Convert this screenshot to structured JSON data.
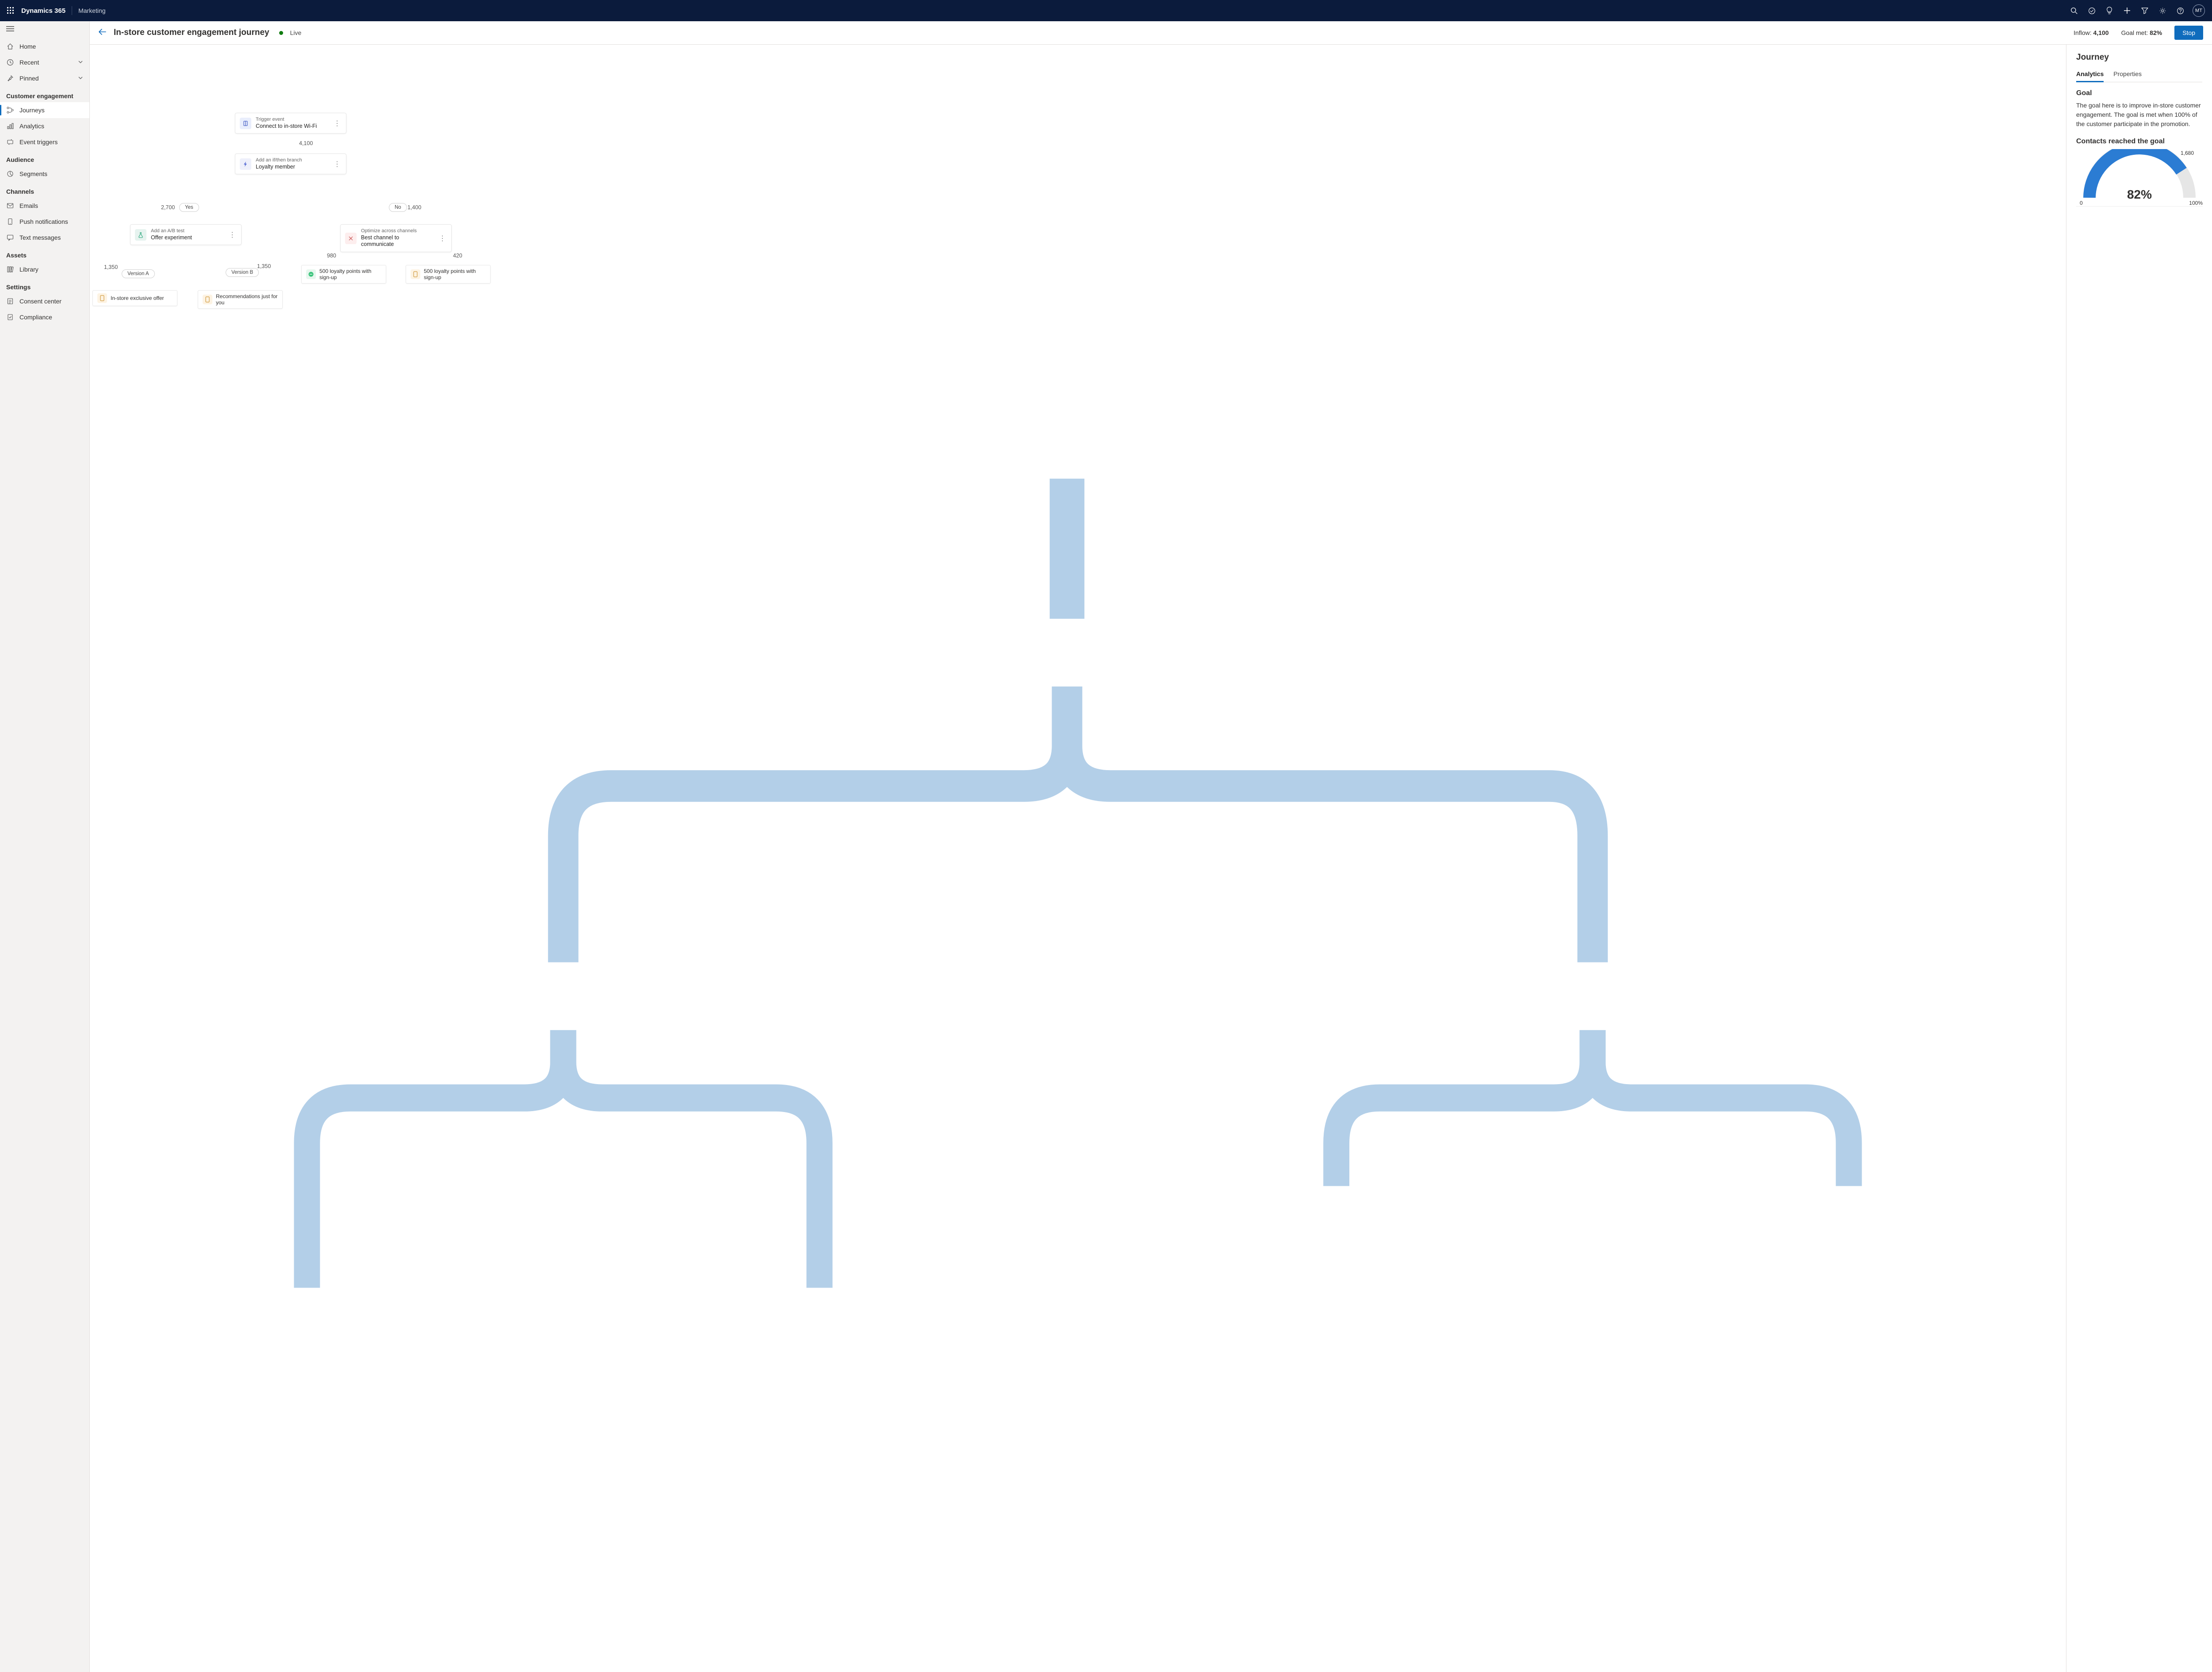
{
  "topbar": {
    "brand": "Dynamics 365",
    "app": "Marketing",
    "avatar": "MT"
  },
  "sidebar": {
    "home": "Home",
    "recent": "Recent",
    "pinned": "Pinned",
    "section_engagement": "Customer engagement",
    "journeys": "Journeys",
    "analytics": "Analytics",
    "event_triggers": "Event triggers",
    "section_audience": "Audience",
    "segments": "Segments",
    "section_channels": "Channels",
    "emails": "Emails",
    "push": "Push notifications",
    "text": "Text messages",
    "section_assets": "Assets",
    "library": "Library",
    "section_settings": "Settings",
    "consent": "Consent center",
    "compliance": "Compliance"
  },
  "header": {
    "title": "In-store customer engagement journey",
    "status": "Live",
    "inflow_label": "Inflow:",
    "inflow_value": "4,100",
    "goal_label": "Goal met:",
    "goal_value": "82%",
    "stop": "Stop"
  },
  "journey": {
    "trigger": {
      "top": "Trigger event",
      "bot": "Connect to in-store Wi-Fi"
    },
    "count1": "4,100",
    "ifthen": {
      "top": "Add an if/then branch",
      "bot": "Loyalty member"
    },
    "yes_count": "2,700",
    "yes": "Yes",
    "no": "No",
    "no_count": "1,400",
    "ab": {
      "top": "Add an A/B test",
      "bot": "Offer experiment"
    },
    "opt": {
      "top": "Optimize across channels",
      "bot": "Best channel to communicate"
    },
    "va_count": "1,350",
    "va": "Version A",
    "vb_count": "1,350",
    "vb": "Version B",
    "opt_left_count": "980",
    "opt_right_count": "420",
    "leafA": "In-store exclusive offer",
    "leafB": "Recommendations just for you",
    "leafC": "500 loyalty points with sign-up",
    "leafD": "500 loyalty points with sign-up"
  },
  "rpanel": {
    "title": "Journey",
    "tab_analytics": "Analytics",
    "tab_properties": "Properties",
    "goal_h": "Goal",
    "goal_body": "The goal here is to improve in-store customer engagement. The goal is met when 100% of the customer participate in the promotion.",
    "contacts_h": "Contacts reached the goal",
    "gauge_mark": "1,680",
    "gauge_pct": "82%",
    "gauge_0": "0",
    "gauge_100": "100%"
  },
  "chart_data": {
    "type": "gauge",
    "title": "Contacts reached the goal",
    "value_pct": 82,
    "value_count": 1680,
    "range": [
      0,
      100
    ],
    "unit": "%"
  }
}
